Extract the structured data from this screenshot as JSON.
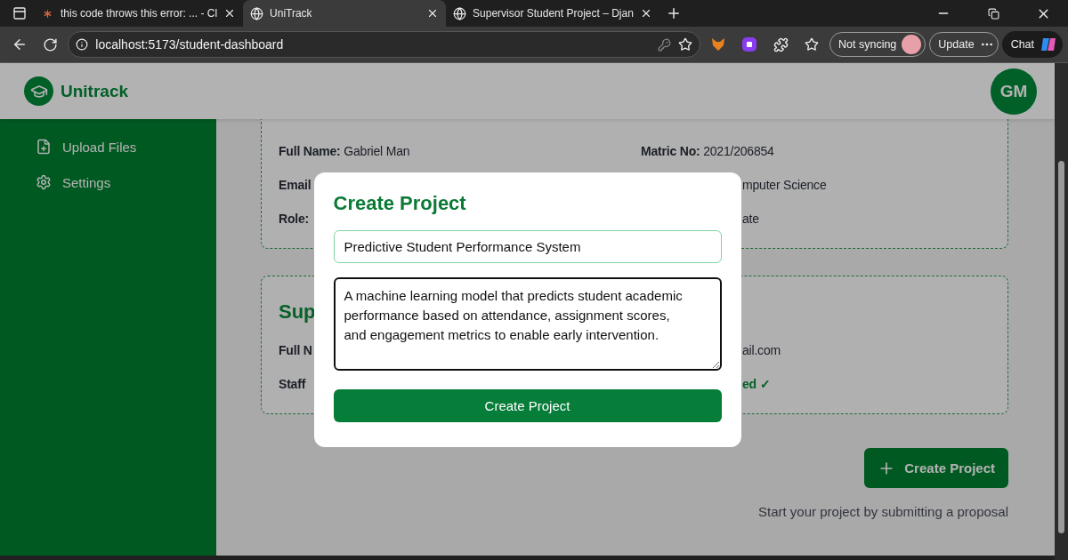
{
  "browser": {
    "tabs": [
      {
        "title": "this code throws this error: ... - Cl",
        "selected": false
      },
      {
        "title": "UniTrack",
        "selected": true
      },
      {
        "title": "Supervisor Student Project – Djan",
        "selected": false
      }
    ],
    "address": "localhost:5173/student-dashboard",
    "sync_label": "Not syncing",
    "update_label": "Update",
    "chat_label": "Chat"
  },
  "app": {
    "brand": "Unitrack",
    "avatar": "GM",
    "sidebar": {
      "items": [
        {
          "label": "Upload Files",
          "kind": "upload"
        },
        {
          "label": "Settings",
          "kind": "settings"
        }
      ]
    },
    "profile_card": {
      "rows": [
        {
          "left_label": "Full Name:",
          "left_value": "Gabriel Man",
          "right_label": "Matric No:",
          "right_value": "2021/206854",
          "covered": false
        },
        {
          "left_label": "Email",
          "right_value": "mputer Science",
          "covered": true
        },
        {
          "left_label": "Role:",
          "right_value": "ate",
          "covered": true
        }
      ]
    },
    "supervisor_card": {
      "heading": "Sup",
      "rows": [
        {
          "left_label": "Full N",
          "right_value": "ail.com",
          "verified": false
        },
        {
          "left_label": "Staff",
          "right_value": "ed ✓",
          "verified": true
        }
      ]
    },
    "create_button": "Create Project",
    "hint": "Start your project by submitting a proposal"
  },
  "modal": {
    "title": "Create Project",
    "title_value": "Predictive Student Performance System",
    "description_value": "A machine learning model that predicts student academic performance based on attendance, assignment scores, and engagement metrics to enable early intervention.",
    "submit": "Create Project"
  }
}
